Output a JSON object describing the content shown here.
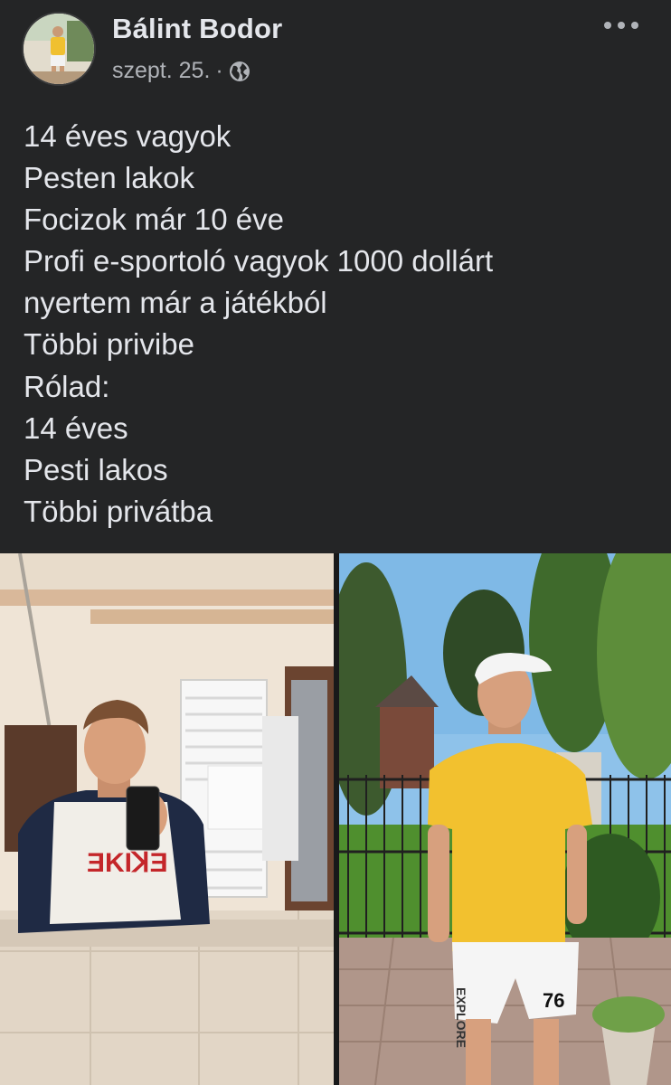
{
  "post": {
    "author": "Bálint Bodor",
    "date": "szept. 25.",
    "separator": "·",
    "audience_icon": "globe-icon",
    "more_icon": "more-options-icon",
    "lines": [
      "14 éves vagyok",
      "Pesten lakok",
      "Focizok már 10 éve",
      "Profi e-sportoló vagyok 1000 dollárt",
      "nyertem már a játékból",
      "Többi privibe",
      "Rólad:",
      "14 éves",
      "Pesti lakos",
      "Többi privátba"
    ]
  },
  "photos": {
    "left": {
      "description_icon": "bathroom-mirror-selfie-photo",
      "shirt_text": "ƎKIꓘƎ",
      "phone_color": "#1a1a1a"
    },
    "right": {
      "description_icon": "garden-portrait-photo",
      "shorts_text": "EXPLORE",
      "shorts_number": "76"
    }
  },
  "colors": {
    "background": "#242526",
    "text_primary": "#e4e6eb",
    "text_secondary": "#b0b3b8"
  }
}
